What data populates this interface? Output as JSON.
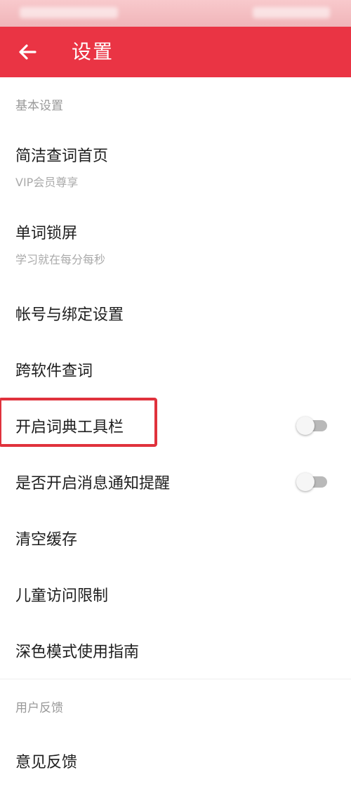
{
  "header": {
    "title": "设置",
    "back_icon": "arrow-left-icon",
    "color": "#ea3444"
  },
  "sections": [
    {
      "title": "基本设置",
      "items": [
        {
          "title": "简洁查词首页",
          "subtitle": "VIP会员尊享"
        },
        {
          "title": "单词锁屏",
          "subtitle": "学习就在每分每秒"
        },
        {
          "title": "帐号与绑定设置"
        },
        {
          "title": "跨软件查词"
        },
        {
          "title": "开启词典工具栏",
          "toggle": false,
          "highlighted": true
        },
        {
          "title": "是否开启消息通知提醒",
          "toggle": false
        },
        {
          "title": "清空缓存"
        },
        {
          "title": "儿童访问限制"
        },
        {
          "title": "深色模式使用指南"
        }
      ]
    },
    {
      "title": "用户反馈",
      "items": [
        {
          "title": "意见反馈"
        }
      ]
    }
  ]
}
